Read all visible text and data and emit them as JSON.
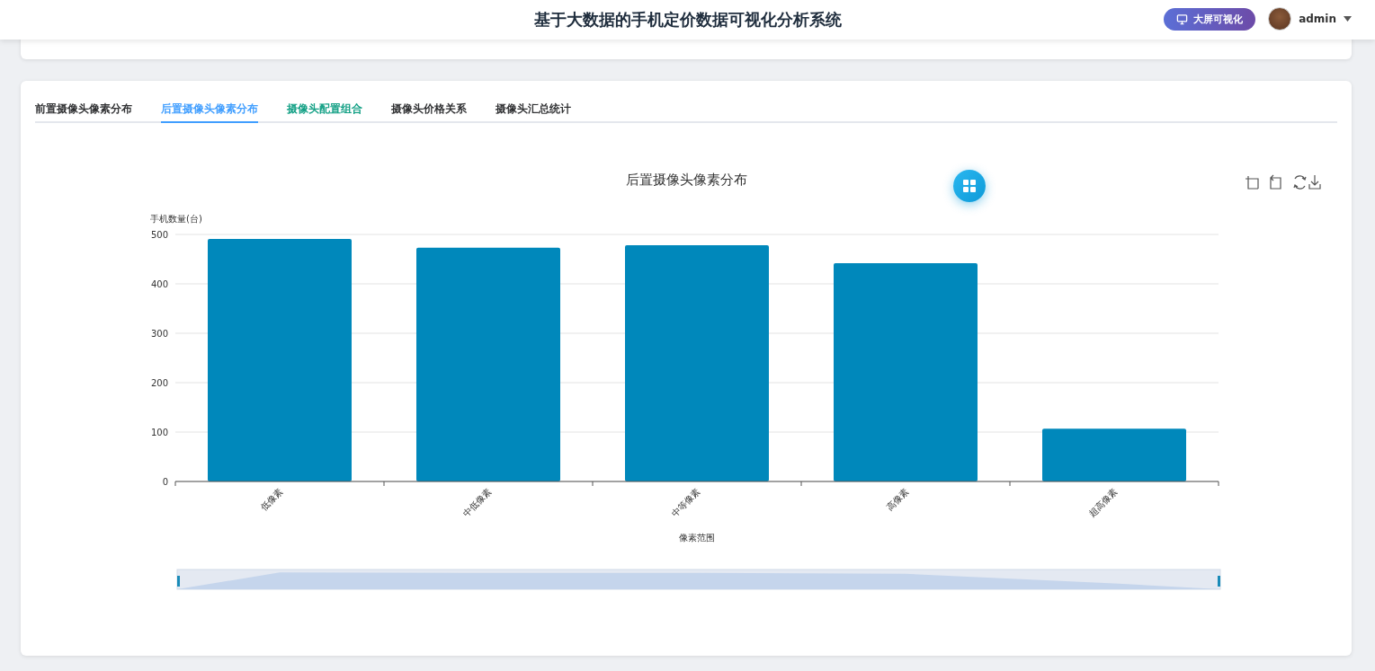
{
  "header": {
    "title": "基于大数据的手机定价数据可视化分析系统",
    "screen_button": "大屏可视化",
    "user": "admin"
  },
  "tabs": [
    {
      "label": "前置摄像头像素分布",
      "selected": false,
      "hovered": false
    },
    {
      "label": "后置摄像头像素分布",
      "selected": true,
      "hovered": false
    },
    {
      "label": "摄像头配置组合",
      "selected": false,
      "hovered": true
    },
    {
      "label": "摄像头价格关系",
      "selected": false,
      "hovered": false
    },
    {
      "label": "摄像头汇总统计",
      "selected": false,
      "hovered": false
    }
  ],
  "chart_data": {
    "type": "bar",
    "title": "后置摄像头像素分布",
    "xlabel": "像素范围",
    "ylabel": "手机数量(台)",
    "categories": [
      "低像素",
      "中低像素",
      "中等像素",
      "高像素",
      "超高像素"
    ],
    "grid": true,
    "series": [
      {
        "color": "#0088bb",
        "values": [
          491,
          473,
          478,
          442,
          107
        ]
      }
    ],
    "ylim": [
      0,
      500
    ],
    "yticks": [
      0,
      100,
      200,
      300,
      400,
      500
    ]
  }
}
